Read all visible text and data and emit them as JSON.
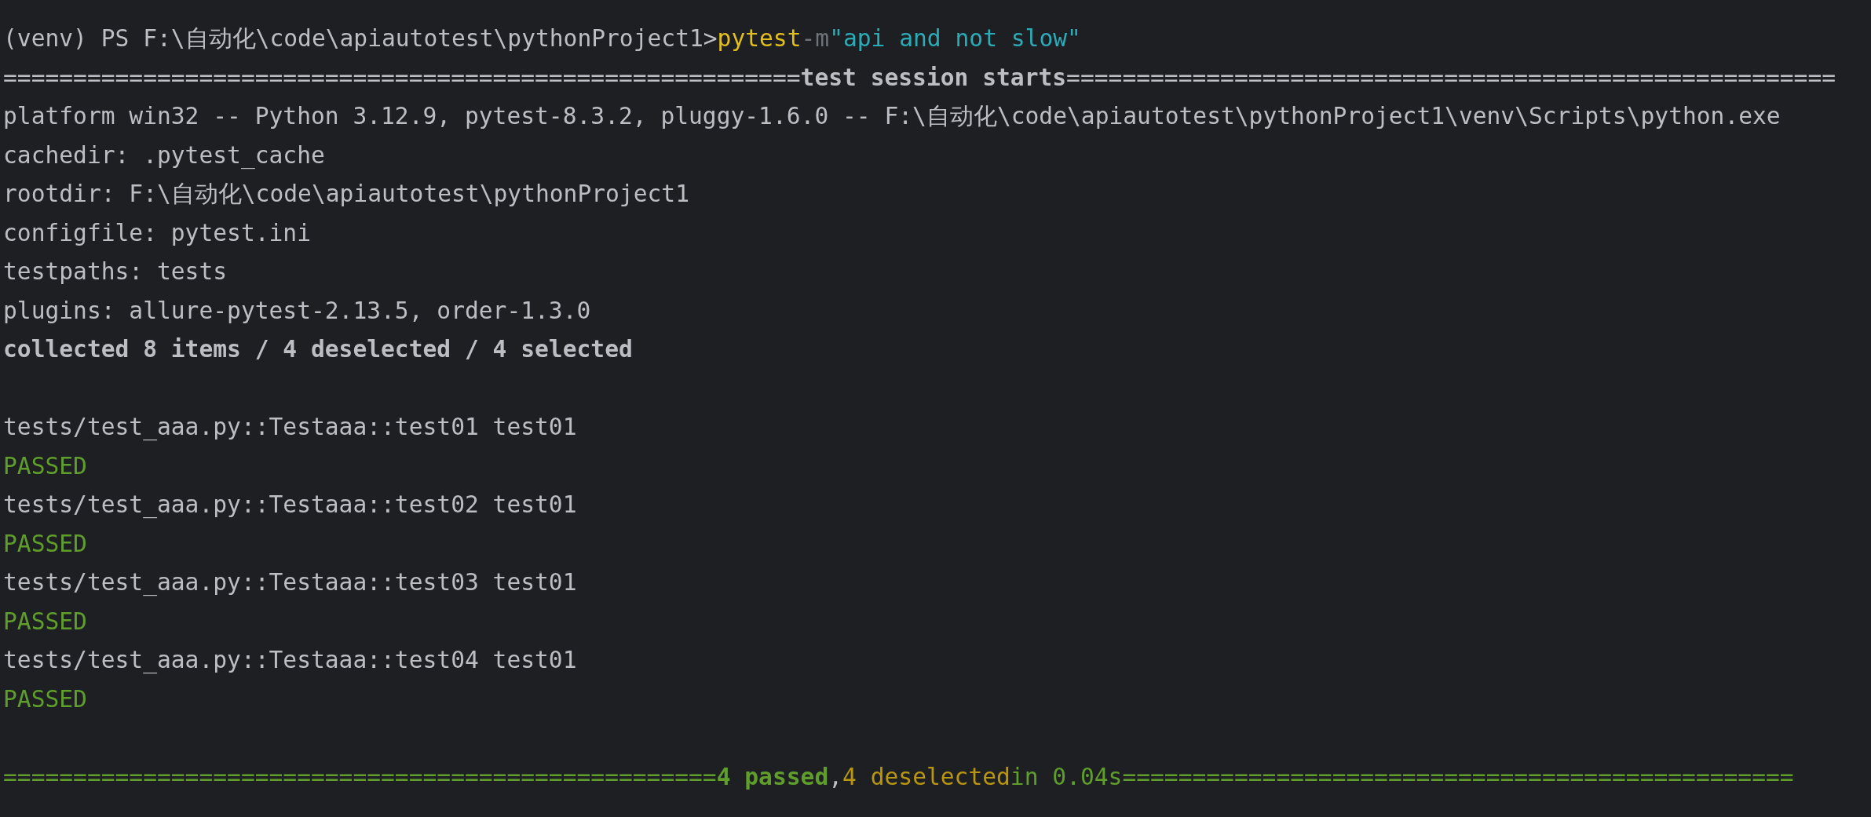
{
  "prompt": {
    "text": "(venv) PS F:\\自动化\\code\\apiautotest\\pythonProject1>",
    "command": "pytest",
    "flag": "-m",
    "argument": "\"api and not slow\""
  },
  "session_header": {
    "left_rule": "=========================================================",
    "title": "test session starts",
    "right_rule": "======================================================="
  },
  "info_lines": [
    "platform win32 -- Python 3.12.9, pytest-8.3.2, pluggy-1.6.0 -- F:\\自动化\\code\\apiautotest\\pythonProject1\\venv\\Scripts\\python.exe",
    "cachedir: .pytest_cache",
    "rootdir: F:\\自动化\\code\\apiautotest\\pythonProject1",
    "configfile: pytest.ini",
    "testpaths: tests",
    "plugins: allure-pytest-2.13.5, order-1.3.0"
  ],
  "collected": "collected 8 items / 4 deselected / 4 selected",
  "results": [
    {
      "test": "tests/test_aaa.py::Testaaa::test01 test01",
      "status": "PASSED",
      "kind": "passed"
    },
    {
      "test": "tests/test_aaa.py::Testaaa::test02 test01",
      "status": "PASSED",
      "kind": "passed"
    },
    {
      "test": "tests/test_aaa.py::Testaaa::test03 test01",
      "status": "PASSED",
      "kind": "passed"
    },
    {
      "test": "tests/test_aaa.py::Testaaa::test04 test01",
      "status": "PASSED",
      "kind": "passed"
    }
  ],
  "summary": {
    "left_rule": "===================================================",
    "passed": "4 passed",
    "separator": ",",
    "deselected": "4 deselected",
    "duration": "in 0.04s",
    "right_rule": "================================================"
  }
}
